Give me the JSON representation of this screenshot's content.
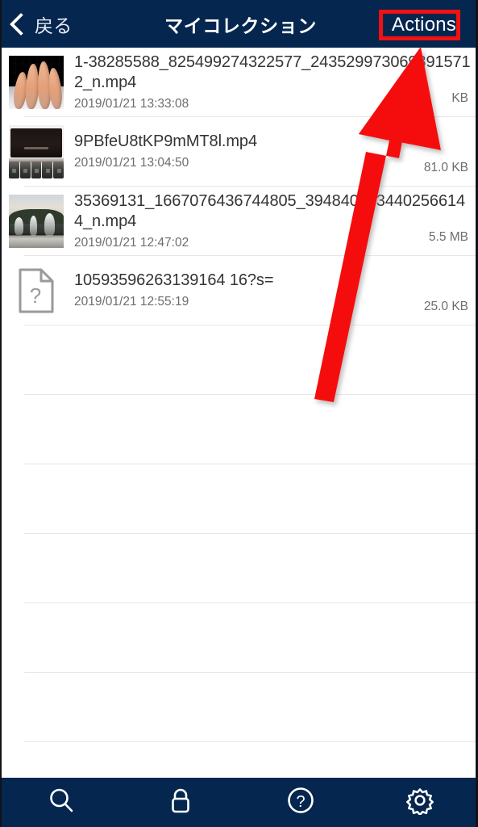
{
  "header": {
    "back_label": "戻る",
    "back_icon": "chevron-left-icon",
    "title": "マイコレクション",
    "actions_label": "Actions",
    "background_color": "#04264f",
    "highlight_color": "#f01111"
  },
  "files": [
    {
      "name": "1-38285588_825499274322577_2435299730698915712_n.mp4",
      "date": "2019/01/21 13:33:08",
      "size": "KB",
      "thumbnail": "keyboard-fingers-thumbnail"
    },
    {
      "name": "9PBfeU8tKP9mMT8l.mp4",
      "date": "2019/01/21 13:04:50",
      "size": "81.0 KB",
      "thumbnail": "macbook-pro-thumbnail"
    },
    {
      "name": "35369131_1667076436744805_3948404834402566144_n.mp4",
      "date": "2019/01/21 12:47:02",
      "size": "5.5 MB",
      "thumbnail": "fountain-park-thumbnail"
    },
    {
      "name": "10593596263139164 16?s=",
      "date": "2019/01/21 12:55:19",
      "size": "25.0 KB",
      "thumbnail": "unknown-file-icon"
    }
  ],
  "empty_row_count": 7,
  "toolbar": {
    "items": [
      {
        "icon": "search-icon"
      },
      {
        "icon": "lock-icon"
      },
      {
        "icon": "help-circle-icon"
      },
      {
        "icon": "gear-icon"
      }
    ],
    "background_color": "#04264f"
  },
  "annotation": {
    "arrow_color": "#f51010",
    "points_to": "Actions"
  }
}
